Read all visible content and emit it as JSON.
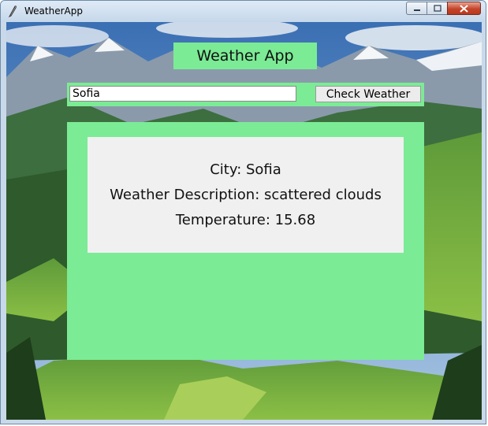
{
  "window": {
    "title": "WeatherApp"
  },
  "app": {
    "heading": "Weather App",
    "city_input_value": "Sofia",
    "check_button_label": "Check Weather"
  },
  "result": {
    "city_line": "City: Sofia",
    "description_line": "Weather Description: scattered clouds",
    "temperature_line": "Temperature: 15.68"
  },
  "colors": {
    "panel_green": "#7beb95",
    "result_background": "#f0f0f0"
  }
}
